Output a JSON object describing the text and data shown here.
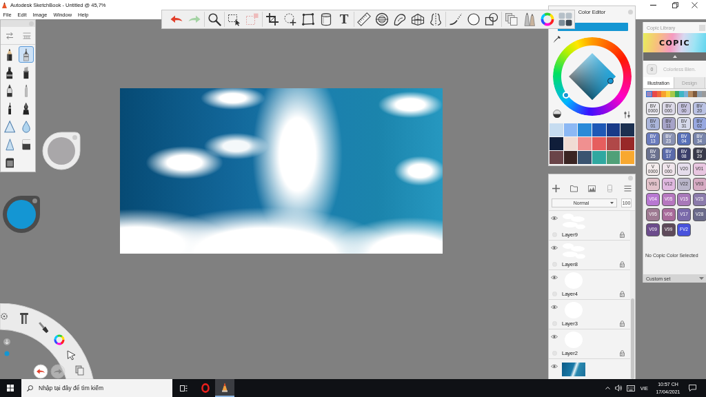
{
  "window": {
    "title": "Autodesk SketchBook - Untitled @ 45,7%"
  },
  "menu": [
    "File",
    "Edit",
    "Image",
    "Window",
    "Help"
  ],
  "toolbar": {
    "groups": [
      [
        {
          "kind": "undo",
          "disabled": false
        },
        {
          "kind": "redo",
          "disabled": true
        }
      ],
      [
        {
          "kind": "zoom",
          "disabled": false
        }
      ],
      [
        {
          "kind": "select",
          "disabled": false
        },
        {
          "kind": "select_clear",
          "disabled": true
        }
      ],
      [
        {
          "kind": "crop",
          "disabled": false
        },
        {
          "kind": "transform",
          "disabled": false
        },
        {
          "kind": "distort",
          "disabled": false
        },
        {
          "kind": "fill",
          "disabled": false
        },
        {
          "kind": "text",
          "glyph": "T",
          "disabled": false
        }
      ],
      [
        {
          "kind": "ruler",
          "disabled": false
        },
        {
          "kind": "ellipse",
          "disabled": false
        },
        {
          "kind": "french_curve",
          "disabled": false
        },
        {
          "kind": "perspective",
          "disabled": false
        },
        {
          "kind": "symmetry",
          "disabled": false
        }
      ],
      [
        {
          "kind": "stroke",
          "disabled": false
        },
        {
          "kind": "circle",
          "disabled": false
        },
        {
          "kind": "shapes",
          "disabled": false
        }
      ],
      [
        {
          "kind": "copic",
          "disabled": false
        },
        {
          "kind": "brushes",
          "disabled": false
        },
        {
          "kind": "color_wheel",
          "disabled": false
        },
        {
          "kind": "swatches",
          "disabled": false
        }
      ]
    ]
  },
  "palette": {
    "brushes": [
      {
        "kind": "pencil",
        "selected": false
      },
      {
        "kind": "technical_pen",
        "selected": true
      },
      {
        "kind": "marker",
        "selected": false
      },
      {
        "kind": "chisel_marker",
        "selected": false
      },
      {
        "kind": "nib_pen",
        "selected": false
      },
      {
        "kind": "ballpoint",
        "selected": false
      },
      {
        "kind": "fineliner",
        "selected": false
      },
      {
        "kind": "ink_pen",
        "selected": false
      },
      {
        "kind": "airbrush",
        "selected": false
      },
      {
        "kind": "blender",
        "selected": false
      },
      {
        "kind": "hard_airbrush",
        "selected": false
      },
      {
        "kind": "eraser",
        "selected": false
      },
      {
        "kind": "block",
        "selected": false
      }
    ]
  },
  "color_editor": {
    "title": "Color Editor",
    "swatches": [
      {
        "color": "#c6dcf0"
      },
      {
        "color": "#8cb8f4"
      },
      {
        "color": "#2a8ad8"
      },
      {
        "color": "#1e58b6"
      },
      {
        "color": "#183a88"
      },
      {
        "color": "#1c3050"
      },
      {
        "color": "#101e3a"
      },
      {
        "color": "#f0dcd4"
      },
      {
        "color": "#f09090"
      },
      {
        "color": "#e65e5e"
      },
      {
        "color": "#b04848"
      },
      {
        "color": "#982828"
      },
      {
        "color": "#6a4448"
      },
      {
        "color": "#3a2422"
      },
      {
        "color": "#3a5470"
      },
      {
        "color": "#30a8a0"
      },
      {
        "color": "#50a078"
      },
      {
        "color": "#f8a830"
      }
    ]
  },
  "copic_library": {
    "title": "Copic Library",
    "logo": "COPIC",
    "blender": {
      "code": "0",
      "name": "Colorless Blen."
    },
    "tabs": [
      {
        "label": "Illustration",
        "selected": true
      },
      {
        "label": "Design",
        "selected": false
      }
    ],
    "families": [
      {
        "color": "#9c86bc",
        "selected": true
      },
      {
        "color": "#e84a4a",
        "selected": false
      },
      {
        "color": "#f06a3a",
        "selected": false
      },
      {
        "color": "#f7a12e",
        "selected": false
      },
      {
        "color": "#f7d23c",
        "selected": false
      },
      {
        "color": "#a8c84a",
        "selected": false
      },
      {
        "color": "#34a862",
        "selected": false
      },
      {
        "color": "#3fb6c6",
        "selected": false
      },
      {
        "color": "#7ab0d6",
        "selected": false
      },
      {
        "color": "#b48a60",
        "selected": false
      },
      {
        "color": "#7e5a3c",
        "selected": false
      },
      {
        "color": "#8fa0b0",
        "selected": false
      },
      {
        "color": "#9a9a9a",
        "selected": false
      }
    ],
    "markers": [
      {
        "code": "BV 0000",
        "color": "#e8e7ee"
      },
      {
        "code": "BV 000",
        "color": "#dcd9e8"
      },
      {
        "code": "BV 00",
        "color": "#c6c3df"
      },
      {
        "code": "BV 20",
        "color": "#b9c1e2"
      },
      {
        "code": "BV 01",
        "color": "#aab5da"
      },
      {
        "code": "BV 11",
        "color": "#a6a3c8"
      },
      {
        "code": "BV 31",
        "color": "#d6daec"
      },
      {
        "code": "BV 02",
        "color": "#97a8e0"
      },
      {
        "code": "BV 13",
        "color": "#6a7bbd"
      },
      {
        "code": "BV 23",
        "color": "#8a92b3"
      },
      {
        "code": "BV 04",
        "color": "#5870b8"
      },
      {
        "code": "BV 34",
        "color": "#7884aa"
      },
      {
        "code": "BV 25",
        "color": "#6a718e"
      },
      {
        "code": "BV 17",
        "color": "#5a6aaa"
      },
      {
        "code": "BV 08",
        "color": "#3b3e6a"
      },
      {
        "code": "BV 29",
        "color": "#393a4a"
      },
      {
        "code": "V 0000",
        "color": "#f4ecec"
      },
      {
        "code": "V 000",
        "color": "#f0e5ec"
      },
      {
        "code": "V20",
        "color": "#e5ddec"
      },
      {
        "code": "V01",
        "color": "#e8c6e0"
      },
      {
        "code": "V91",
        "color": "#e2c2ca"
      },
      {
        "code": "V12",
        "color": "#e0b8e0"
      },
      {
        "code": "V22",
        "color": "#bab6ca"
      },
      {
        "code": "V93",
        "color": "#d6aac2"
      },
      {
        "code": "V04",
        "color": "#b878d2"
      },
      {
        "code": "V05",
        "color": "#b677bf"
      },
      {
        "code": "V15",
        "color": "#a878b9"
      },
      {
        "code": "V25",
        "color": "#8a7aaa"
      },
      {
        "code": "V95",
        "color": "#9e7a92"
      },
      {
        "code": "V06",
        "color": "#a86a9a"
      },
      {
        "code": "V17",
        "color": "#7a6aaa"
      },
      {
        "code": "V28",
        "color": "#6a6a8a"
      },
      {
        "code": "V09",
        "color": "#6c4c8c"
      },
      {
        "code": "V99",
        "color": "#5e4a5a"
      },
      {
        "code": "FV2",
        "color": "#4852dc"
      }
    ],
    "status": "No Copic Color Selected",
    "set": "Custom set"
  },
  "layers": {
    "blend_mode": "Normal",
    "opacity": "100",
    "items": [
      {
        "name": "Layer9",
        "kind": "clouds",
        "visible": true
      },
      {
        "name": "Layer8",
        "kind": "clouds",
        "visible": true
      },
      {
        "name": "Layer4",
        "kind": "blob",
        "visible": true
      },
      {
        "name": "Layer3",
        "kind": "blob",
        "visible": true
      },
      {
        "name": "Layer2",
        "kind": "blob",
        "visible": true
      },
      {
        "kind": "photo",
        "visible": true
      }
    ]
  },
  "radial_menu": {
    "buttons": [
      {
        "kind": "undo",
        "disabled": false
      },
      {
        "kind": "redo",
        "disabled": true
      }
    ]
  },
  "taskbar": {
    "search": {
      "placeholder": "Nhập tại đây để tìm kiếm"
    },
    "apps": [
      {
        "kind": "browser",
        "selected": false
      },
      {
        "kind": "sketch",
        "selected": true
      }
    ],
    "language": "VIE",
    "time": "10:57 CH",
    "date": "17/04/2021"
  }
}
